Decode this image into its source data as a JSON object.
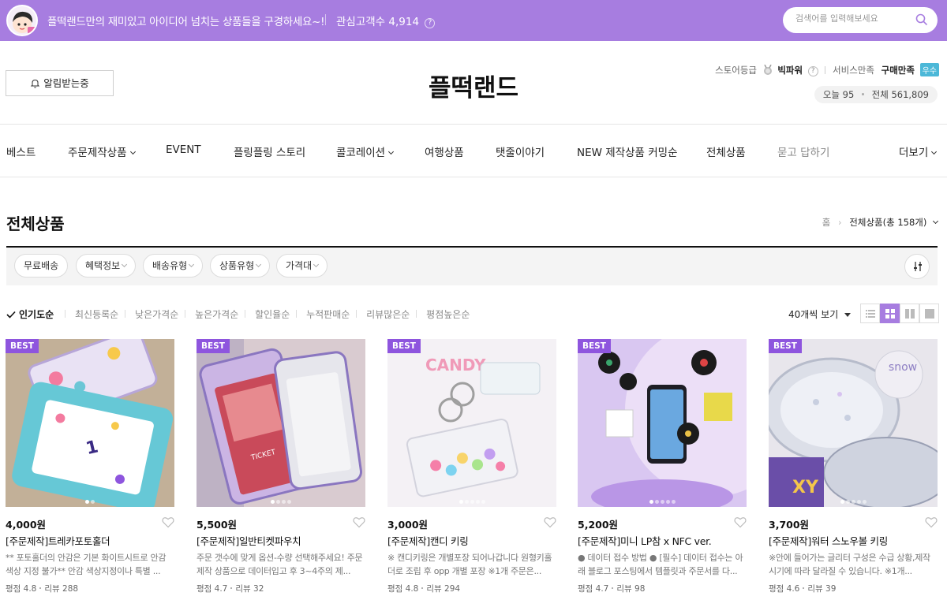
{
  "topbar": {
    "tagline": "플떡랜드만의 재미있고 아이디어 넘치는 상품들을 구경하세요~!",
    "favorites_label": "관심고객수",
    "favorites_count": "4,914",
    "search_placeholder": "검색어를 입력해보세요",
    "bg_color": "#a77de0"
  },
  "header": {
    "notify_label": "알림받는중",
    "store_name": "플떡랜드",
    "grade_label": "스토어등급",
    "grade_value": "빅파워",
    "service_label": "서비스만족",
    "purchase_label": "구매만족",
    "purchase_badge": "우수",
    "today_label": "오늘",
    "today_count": "95",
    "total_label": "전체",
    "total_count": "561,809"
  },
  "nav": {
    "items": [
      {
        "label": "베스트"
      },
      {
        "label": "주문제작상품"
      },
      {
        "label": "EVENT"
      },
      {
        "label": "플링플링 스토리"
      },
      {
        "label": "콜코레이션"
      },
      {
        "label": "여행상품"
      },
      {
        "label": "탯줄이야기"
      },
      {
        "label": "NEW 제작상품 커밍순"
      },
      {
        "label": "전체상품"
      },
      {
        "label": "묻고 답하기"
      }
    ],
    "more_label": "더보기"
  },
  "page": {
    "title": "전체상품",
    "breadcrumb_home": "홈",
    "breadcrumb_current": "전체상품(총 158개)"
  },
  "filters": [
    "무료배송",
    "혜택정보",
    "배송유형",
    "상품유형",
    "가격대"
  ],
  "sort": {
    "options": [
      "인기도순",
      "최신등록순",
      "낮은가격순",
      "높은가격순",
      "할인율순",
      "누적판매순",
      "리뷰많은순",
      "평점높은순"
    ],
    "active_index": 0,
    "per_page": "40개씩 보기"
  },
  "products": [
    {
      "badge": "BEST",
      "price": "4,000원",
      "name": "[주문제작]트레카포토홀더",
      "desc": "** 포토홀더의 안감은 기본 화이트시트로 안감 색상 지정 불가** 안감 색상지정이나 특별 ...",
      "rating_label": "평점 4.8",
      "review_label": "리뷰 288"
    },
    {
      "badge": "BEST",
      "price": "5,500원",
      "name": "[주문제작]일반티켓파우치",
      "desc": "주문 갯수에 맞게 옵션-수량 선택해주세요! 주문제작 상품으로 데이터입고 후 3~4주의 제...",
      "rating_label": "평점 4.7",
      "review_label": "리뷰 32"
    },
    {
      "badge": "BEST",
      "price": "3,000원",
      "name": "[주문제작]캔디 키링",
      "desc": "※ 캔디키링은 개별포장 되어나갑니다 원형키홀더로 조립 후 opp 개별 포장 ※1개 주문은...",
      "rating_label": "평점 4.8",
      "review_label": "리뷰 294"
    },
    {
      "badge": "BEST",
      "price": "5,200원",
      "name": "[주문제작]미니 LP참 x NFC ver.",
      "desc": "● 데이터 접수 방법 ● [필수] 데이터 접수는 아래 블로그 포스팅에서 템플릿과 주문서를 다...",
      "rating_label": "평점 4.7",
      "review_label": "리뷰 98"
    },
    {
      "badge": "BEST",
      "price": "3,700원",
      "name": "[주문제작]워터 스노우볼 키링",
      "desc": "※안에 들어가는 글리터 구성은 수급 상황,제작 시기에 따라 달라질 수 있습니다. ※1개...",
      "rating_label": "평점 4.6",
      "review_label": "리뷰 39"
    }
  ]
}
